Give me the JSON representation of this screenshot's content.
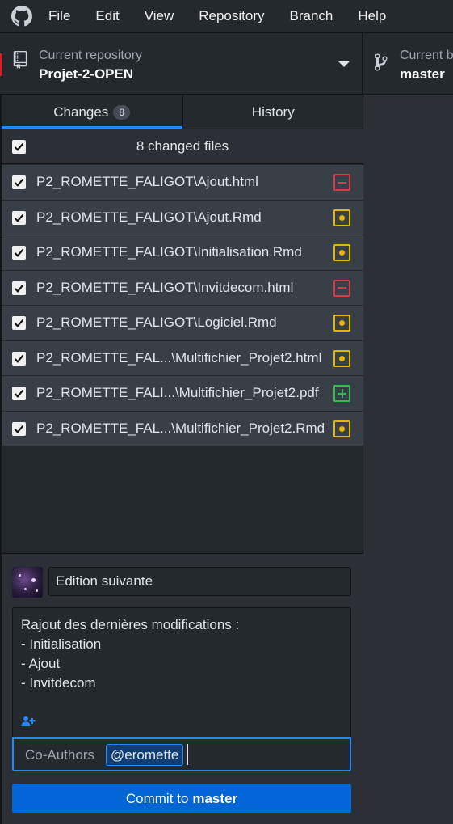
{
  "menu": {
    "logo_icon": "github-octocat-icon",
    "items": [
      "File",
      "Edit",
      "View",
      "Repository",
      "Branch",
      "Help"
    ]
  },
  "toolbar": {
    "repo_label": "Current repository",
    "repo_name": "Projet-2-OPEN",
    "branch_label": "Current branch",
    "branch_name": "master"
  },
  "tabs": {
    "changes_label": "Changes",
    "changes_count": "8",
    "history_label": "History"
  },
  "changes": {
    "header": "8 changed files",
    "files": [
      {
        "path": "P2_ROMETTE_FALIGOT\\Ajout.html",
        "status": "deleted"
      },
      {
        "path": "P2_ROMETTE_FALIGOT\\Ajout.Rmd",
        "status": "modified"
      },
      {
        "path": "P2_ROMETTE_FALIGOT\\Initialisation.Rmd",
        "status": "modified"
      },
      {
        "path": "P2_ROMETTE_FALIGOT\\Invitdecom.html",
        "status": "deleted"
      },
      {
        "path": "P2_ROMETTE_FALIGOT\\Logiciel.Rmd",
        "status": "modified"
      },
      {
        "path": "P2_ROMETTE_FAL...\\Multifichier_Projet2.html",
        "status": "modified"
      },
      {
        "path": "P2_ROMETTE_FALI...\\Multifichier_Projet2.pdf",
        "status": "added"
      },
      {
        "path": "P2_ROMETTE_FAL...\\Multifichier_Projet2.Rmd",
        "status": "modified"
      }
    ]
  },
  "commit": {
    "summary": "Edition suivante",
    "description_lines": [
      "Rajout des dernières modifications :",
      "- Initialisation",
      "- Ajout",
      "- Invitdecom"
    ],
    "coauthors_label": "Co-Authors",
    "coauthor": "@eromette",
    "button_prefix": "Commit to",
    "button_branch": "master"
  },
  "colors": {
    "accent": "#0366d6",
    "modified": "#e5b600",
    "deleted": "#d73a49",
    "added": "#2cbe4e"
  }
}
